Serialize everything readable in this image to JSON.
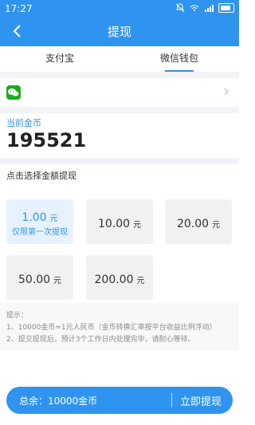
{
  "status": {
    "time": "17:27"
  },
  "header": {
    "title": "提现"
  },
  "tabs": [
    {
      "label": "支付宝",
      "active": false
    },
    {
      "label": "微信钱包",
      "active": true
    }
  ],
  "current_gold": {
    "label": "当前金币",
    "value": "195521"
  },
  "select": {
    "title": "点击选择金额提现",
    "unit": "元",
    "options": [
      {
        "amount": "1.00",
        "note": "仅限第一次提现",
        "selected": true
      },
      {
        "amount": "10.00",
        "note": "",
        "selected": false
      },
      {
        "amount": "20.00",
        "note": "",
        "selected": false
      },
      {
        "amount": "50.00",
        "note": "",
        "selected": false
      },
      {
        "amount": "200.00",
        "note": "",
        "selected": false
      }
    ]
  },
  "tips": {
    "title": "提示：",
    "lines": [
      "1、10000金币≈1元人民币（金币转换汇率按平台收益比例浮动）",
      "2、提交提现后，预计3个工作日内处理完毕，请耐心等待。"
    ]
  },
  "bottom_bar": {
    "total_label": "总余：10000金币",
    "withdraw_label": "立即提现"
  },
  "colors": {
    "accent": "#2f93f0",
    "wechat_green": "#1aad19"
  },
  "icons": {
    "back": "chevron-left-icon",
    "notifications": "bell-off-icon",
    "wifi": "wifi-icon",
    "signal": "signal-icon",
    "battery": "battery-icon",
    "wechat": "wechat-icon",
    "chevron_right": "chevron-right-icon"
  }
}
